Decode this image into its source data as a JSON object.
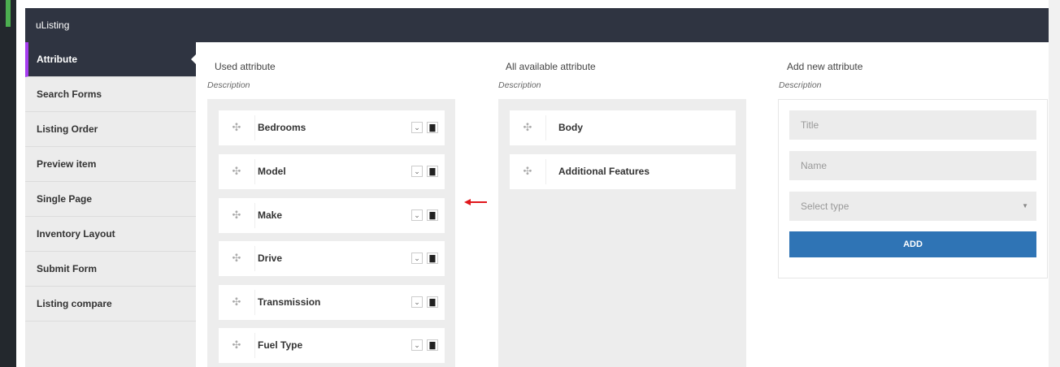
{
  "header": {
    "title": "uListing"
  },
  "sidebar": {
    "items": [
      {
        "label": "Attribute",
        "active": true
      },
      {
        "label": "Search Forms"
      },
      {
        "label": "Listing Order"
      },
      {
        "label": "Preview item"
      },
      {
        "label": "Single Page"
      },
      {
        "label": "Inventory Layout"
      },
      {
        "label": "Submit Form"
      },
      {
        "label": "Listing compare"
      }
    ]
  },
  "columns": {
    "used": {
      "title": "Used attribute",
      "description": "Description"
    },
    "available": {
      "title": "All available attribute",
      "description": "Description"
    },
    "add": {
      "title": "Add new attribute",
      "description": "Description"
    }
  },
  "used_attributes": [
    "Bedrooms",
    "Model",
    "Make",
    "Drive",
    "Transmission",
    "Fuel Type"
  ],
  "available_attributes": [
    "Body",
    "Additional Features"
  ],
  "form": {
    "title_placeholder": "Title",
    "name_placeholder": "Name",
    "type_placeholder": "Select type",
    "add_label": "ADD"
  },
  "icons": {
    "drag": "move-icon",
    "expand": "chevron-down-icon",
    "delete": "trash-icon",
    "arrow": "arrow-left-icon"
  },
  "colors": {
    "header_bg": "#2f3441",
    "active_accent": "#a63df0",
    "add_button": "#2f74b5",
    "arrow": "#e0161b"
  }
}
